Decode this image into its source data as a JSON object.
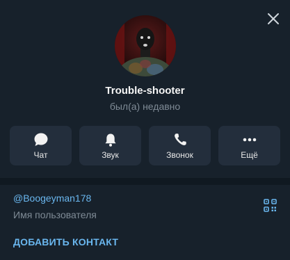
{
  "profile": {
    "name": "Trouble-shooter",
    "status": "был(а) недавно",
    "avatar_icon": "user-avatar-photo"
  },
  "actions": [
    {
      "label": "Чат",
      "icon": "chat-bubble-icon"
    },
    {
      "label": "Звук",
      "icon": "bell-icon"
    },
    {
      "label": "Звонок",
      "icon": "phone-icon"
    },
    {
      "label": "Ещё",
      "icon": "more-dots-icon"
    }
  ],
  "info": {
    "username": "@Boogeyman178",
    "username_caption": "Имя пользователя",
    "qr_icon": "qr-code-icon"
  },
  "add_contact_label": "ДОБАВИТЬ КОНТАКТ",
  "colors": {
    "background": "#17212b",
    "button": "#232e3c",
    "accent": "#6ab7ef",
    "muted": "#7f8b96",
    "divider": "#101921"
  }
}
